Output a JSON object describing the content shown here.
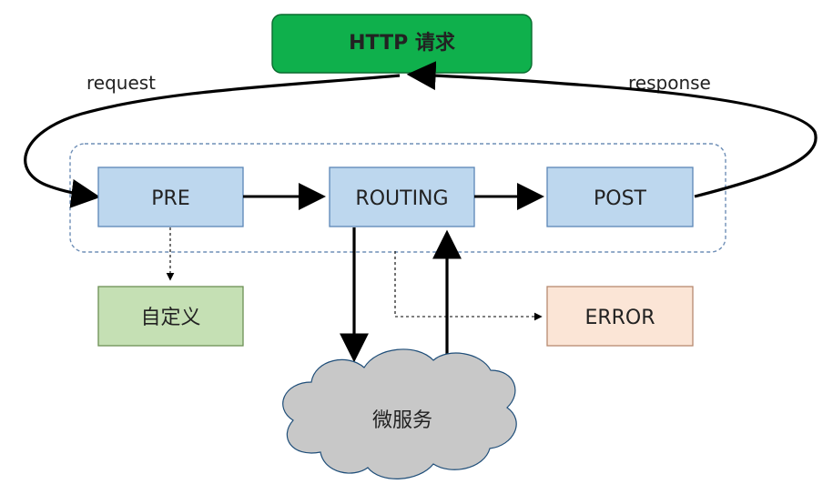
{
  "diagram": {
    "top_node": {
      "label": "HTTP 请求",
      "fill": "#0fb04c",
      "stroke": "#0a6b2f"
    },
    "labels": {
      "request": "request",
      "response": "response"
    },
    "stages": {
      "pre": {
        "label": "PRE",
        "fill": "#bdd7ee",
        "stroke": "#5b86b6"
      },
      "routing": {
        "label": "ROUTING",
        "fill": "#bdd7ee",
        "stroke": "#5b86b6"
      },
      "post": {
        "label": "POST",
        "fill": "#bdd7ee",
        "stroke": "#5b86b6"
      }
    },
    "side_nodes": {
      "custom": {
        "label": "自定义",
        "fill": "#c5e0b4",
        "stroke": "#6c8f54"
      },
      "error": {
        "label": "ERROR",
        "fill": "#fbe5d6",
        "stroke": "#b7896f"
      }
    },
    "service": {
      "label": "微服务",
      "fill": "#c8c8c8",
      "stroke": "#1f4e79"
    },
    "colors": {
      "arrow": "#000000",
      "dashed_container": "#6f8fb7"
    }
  }
}
